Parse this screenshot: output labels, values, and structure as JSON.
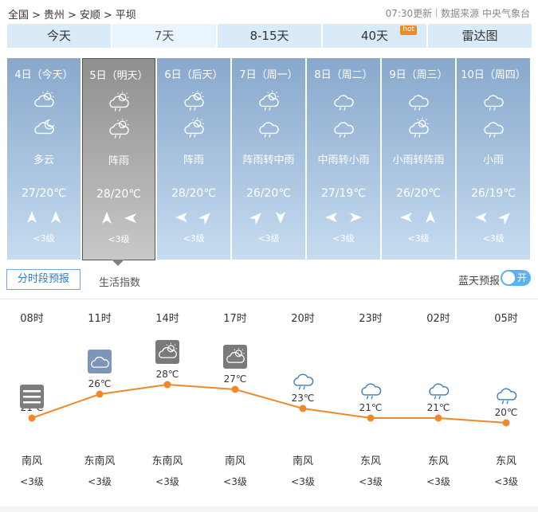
{
  "breadcrumb": [
    "全国",
    ">",
    "贵州",
    ">",
    "安顺",
    ">",
    "平坝"
  ],
  "update_time": "07:30更新",
  "data_source": "数据来源 中央气象台",
  "tabs": [
    {
      "label": "今天",
      "active": false
    },
    {
      "label": "7天",
      "active": true
    },
    {
      "label": "8-15天",
      "active": false
    },
    {
      "label": "40天",
      "active": false,
      "badge": "hot"
    },
    {
      "label": "雷达图",
      "active": false
    }
  ],
  "days": [
    {
      "date": "4日（今天）",
      "icon1": "partly-cloudy-day-icon",
      "icon2": "partly-cloudy-night-icon",
      "weather": "多云",
      "temp": "27/20℃",
      "wind1": "n",
      "wind2": "n",
      "level": "<3级",
      "selected": false
    },
    {
      "date": "5日（明天）",
      "icon1": "shower-day-icon",
      "icon2": "shower-day-icon",
      "weather": "阵雨",
      "temp": "28/20℃",
      "wind1": "n",
      "wind2": "w",
      "level": "<3级",
      "selected": true
    },
    {
      "date": "6日（后天）",
      "icon1": "shower-day-icon",
      "icon2": "shower-day-icon",
      "weather": "阵雨",
      "temp": "28/20℃",
      "wind1": "w",
      "wind2": "ne",
      "level": "<3级",
      "selected": false
    },
    {
      "date": "7日（周一）",
      "icon1": "shower-day-icon",
      "icon2": "rain-icon",
      "weather": "阵雨转中雨",
      "temp": "26/20℃",
      "wind1": "ne",
      "wind2": "s",
      "level": "<3级",
      "selected": false
    },
    {
      "date": "8日（周二）",
      "icon1": "rain-icon",
      "icon2": "rain-icon",
      "weather": "中雨转小雨",
      "temp": "27/19℃",
      "wind1": "w",
      "wind2": "e",
      "level": "<3级",
      "selected": false
    },
    {
      "date": "9日（周三）",
      "icon1": "rain-icon",
      "icon2": "shower-day-icon",
      "weather": "小雨转阵雨",
      "temp": "26/20℃",
      "wind1": "w",
      "wind2": "n",
      "level": "<3级",
      "selected": false
    },
    {
      "date": "10日（周四）",
      "icon1": "rain-icon",
      "icon2": "rain-icon",
      "weather": "小雨",
      "temp": "26/19℃",
      "wind1": "w",
      "wind2": "ne",
      "level": "<3级",
      "selected": false
    }
  ],
  "subtabs": {
    "hourly": "分时段预报",
    "life": "生活指数"
  },
  "blue_sky": {
    "label": "蓝天预报",
    "toggle": "开"
  },
  "hourly": [
    {
      "time": "08时",
      "temp": 21,
      "temp_label": "21℃",
      "icon": "fog-icon",
      "wind": "南风",
      "level": "<3级"
    },
    {
      "time": "11时",
      "temp": 26,
      "temp_label": "26℃",
      "icon": "cloudy-icon",
      "wind": "东南风",
      "level": "<3级"
    },
    {
      "time": "14时",
      "temp": 28,
      "temp_label": "28℃",
      "icon": "partly-cloudy-day-icon",
      "wind": "东南风",
      "level": "<3级"
    },
    {
      "time": "17时",
      "temp": 27,
      "temp_label": "27℃",
      "icon": "partly-cloudy-day-icon",
      "wind": "南风",
      "level": "<3级"
    },
    {
      "time": "20时",
      "temp": 23,
      "temp_label": "23℃",
      "icon": "light-rain-icon",
      "wind": "南风",
      "level": "<3级"
    },
    {
      "time": "23时",
      "temp": 21,
      "temp_label": "21℃",
      "icon": "light-rain-icon",
      "wind": "东风",
      "level": "<3级"
    },
    {
      "time": "02时",
      "temp": 21,
      "temp_label": "21℃",
      "icon": "light-rain-icon",
      "wind": "东风",
      "level": "<3级"
    },
    {
      "time": "05时",
      "temp": 20,
      "temp_label": "20℃",
      "icon": "light-rain-icon",
      "wind": "东风",
      "level": "<3级"
    }
  ],
  "colors": {
    "line": "#f0882a",
    "tab_bg": "#d9eaf8",
    "day_top": "#88a8cc",
    "accent_blue": "#2f7bc0"
  }
}
